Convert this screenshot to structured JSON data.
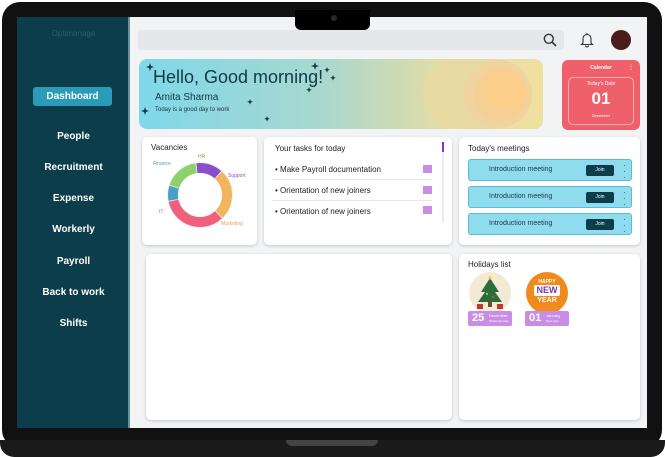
{
  "sidebar": {
    "logo": "Optimanage",
    "active": "Dashboard",
    "items": [
      "People",
      "Recruitment",
      "Expense",
      "Workerly",
      "Payroll",
      "Back to work",
      "Shifts"
    ]
  },
  "hero": {
    "greeting": "Hello, Good morning!",
    "name": "Amita Sharma",
    "subtitle": "Today is a good day to work"
  },
  "calendar": {
    "title": "Calendar",
    "label": "Today's Date",
    "day": "01",
    "month": "December"
  },
  "vacancies": {
    "title": "Vacancies",
    "chart_data": {
      "type": "pie",
      "categories": [
        "Finance",
        "HR",
        "Support",
        "Marketing",
        "IT"
      ],
      "values": [
        8,
        18,
        14,
        26,
        34
      ],
      "colors": [
        "#4a9fc4",
        "#8ed16b",
        "#8a4fc8",
        "#f2b45c",
        "#f0607a"
      ]
    }
  },
  "tasks": {
    "title": "Your tasks for today",
    "items": [
      "Make Payroll documentation",
      "Orientation of new joiners",
      "Orientation of new joiners"
    ]
  },
  "meetings": {
    "title": "Today's meetings",
    "join_label": "Join",
    "items": [
      "Introduction meeting",
      "Introduction meeting",
      "Introduction meeting"
    ]
  },
  "holidays": {
    "title": "Holidays list",
    "items": [
      {
        "day": "25",
        "month": "December",
        "name": "Christmas Day"
      },
      {
        "day": "01",
        "month": "January",
        "name": "New year"
      }
    ],
    "new_year_text": [
      "HAPPY",
      "NEW",
      "YEAR"
    ]
  },
  "colors": {
    "sidebar": "#0c3d4a",
    "accent": "#2a9bb8",
    "calendar": "#f0606a",
    "tag": "#c98de6"
  }
}
